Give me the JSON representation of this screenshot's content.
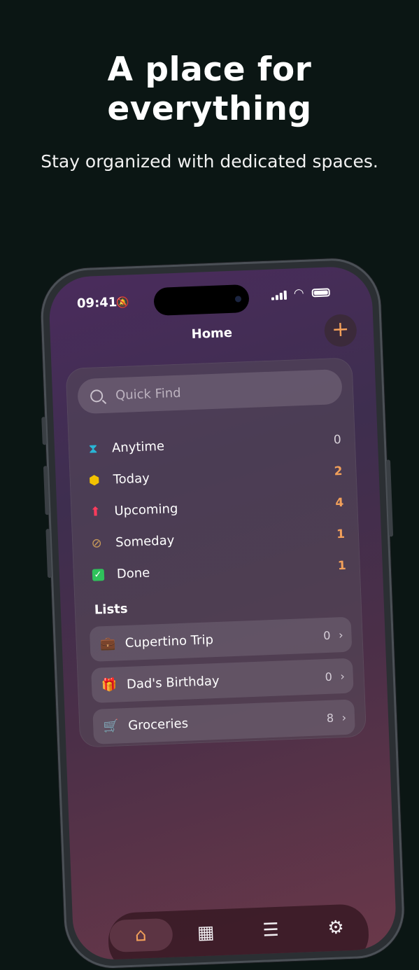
{
  "hero": {
    "title": "A place for everything",
    "subtitle": "Stay organized with dedicated spaces."
  },
  "status_bar": {
    "time": "09:41"
  },
  "nav": {
    "title": "Home",
    "add_label": "+"
  },
  "search": {
    "placeholder": "Quick Find"
  },
  "filters": [
    {
      "label": "Anytime",
      "count": "0",
      "icon": "hourglass-icon",
      "color": "#29b6d6"
    },
    {
      "label": "Today",
      "count": "2",
      "icon": "star-icon",
      "color": "#f2c200"
    },
    {
      "label": "Upcoming",
      "count": "4",
      "icon": "arrow-up-icon",
      "color": "#ff3b5c"
    },
    {
      "label": "Someday",
      "count": "1",
      "icon": "clock-slash-icon",
      "color": "#c79a5a"
    },
    {
      "label": "Done",
      "count": "1",
      "icon": "checkbox-icon",
      "color": "#2fc25b"
    }
  ],
  "count_color": "#f2a05a",
  "lists": {
    "heading": "Lists",
    "items": [
      {
        "label": "Cupertino Trip",
        "count": "0",
        "icon": "suitcase-icon"
      },
      {
        "label": "Dad's Birthday",
        "count": "0",
        "icon": "gift-icon"
      },
      {
        "label": "Groceries",
        "count": "8",
        "icon": "cart-icon"
      }
    ]
  },
  "tabs": [
    {
      "name": "home-tab",
      "icon": "home-icon",
      "active": true
    },
    {
      "name": "calendar-tab",
      "icon": "calendar-icon",
      "active": false
    },
    {
      "name": "lists-tab",
      "icon": "list-icon",
      "active": false
    },
    {
      "name": "settings-tab",
      "icon": "gear-icon",
      "active": false
    }
  ]
}
